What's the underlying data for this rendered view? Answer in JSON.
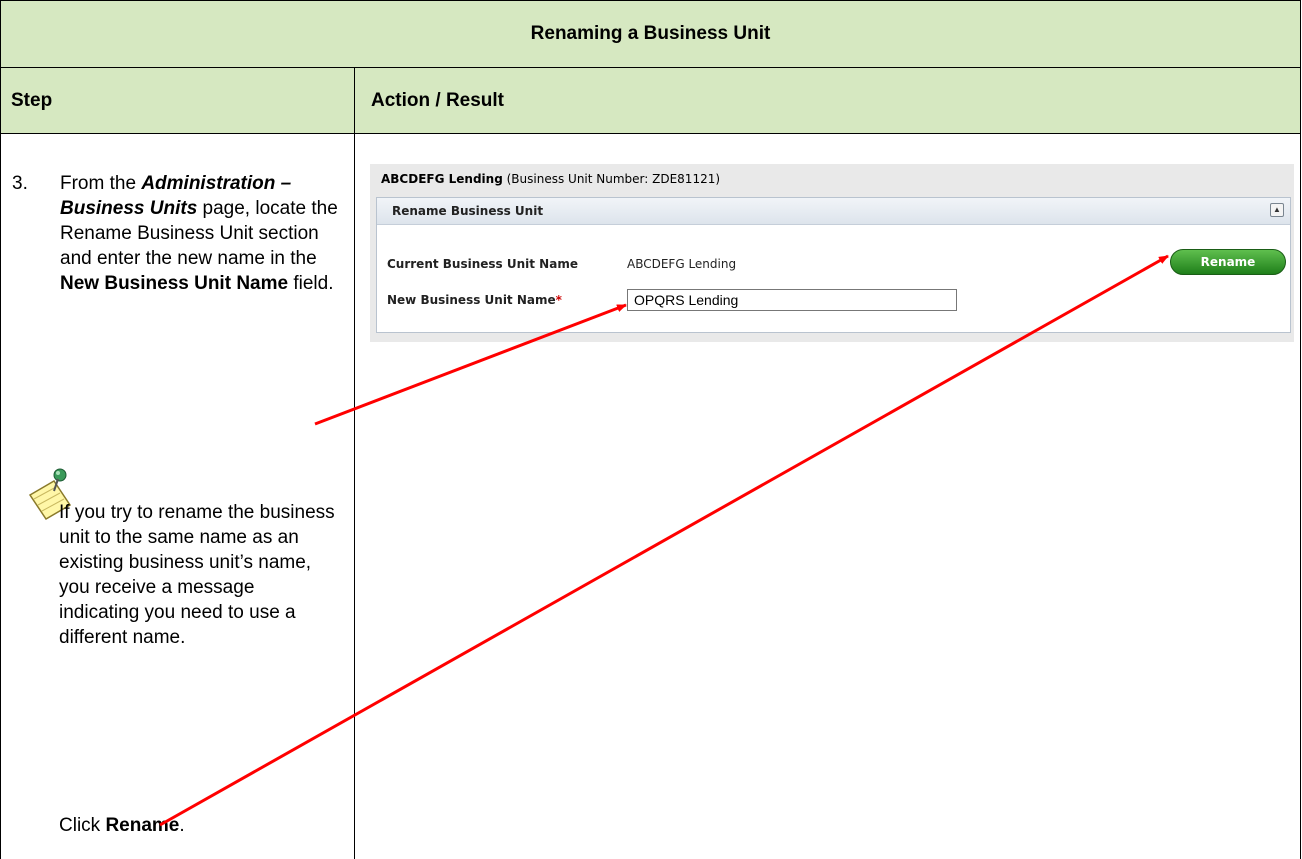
{
  "doc": {
    "title": "Renaming a Business Unit",
    "col_step": "Step",
    "col_action": "Action / Result"
  },
  "step": {
    "number": "3.",
    "body_part1": "From the ",
    "body_bold_italic": "Administration – Business Units",
    "body_part2": " page, locate the Rename Business Unit section and enter the new name in the ",
    "body_bold": "New Business Unit Name",
    "body_part3": " field.",
    "note_icon": "notepad-pushpin-icon",
    "note": "If you try to rename the business unit to the same name as an existing business unit’s name, you receive a message indicating you need to use a different name.",
    "click_prefix": "Click ",
    "click_bold": "Rename",
    "click_suffix": "."
  },
  "screenshot": {
    "bu_name": "ABCDEFG Lending",
    "bu_number_text": "(Business Unit Number: ZDE81121)",
    "panel_title": "Rename Business Unit",
    "collapse_icon": "collapse-up-icon",
    "current_label": "Current Business Unit Name",
    "current_value": "ABCDEFG Lending",
    "new_label": "New Business Unit Name",
    "required_mark": "*",
    "new_value": "OPQRS Lending",
    "rename_button": "Rename",
    "button_color": "#2e8f26"
  },
  "annotation_color": "#ff0000"
}
